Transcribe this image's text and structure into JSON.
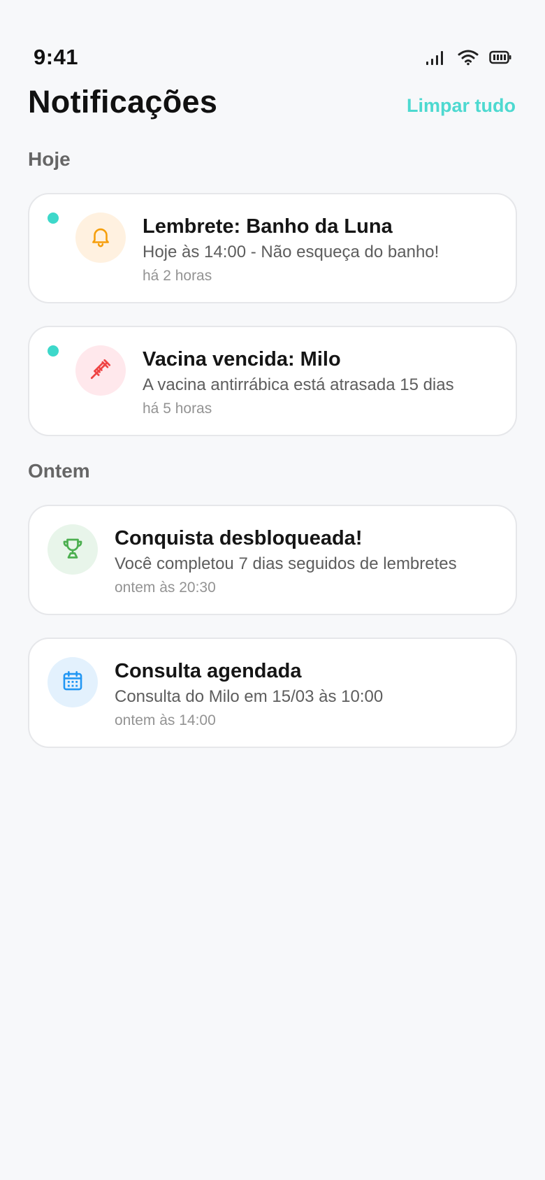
{
  "status_bar": {
    "time": "9:41"
  },
  "header": {
    "title": "Notificações",
    "clear_all_label": "Limpar tudo"
  },
  "colors": {
    "accent": "#4dd9d0",
    "unread_dot": "#3dd8ca",
    "bell_bg": "#fff1e0",
    "bell_fg": "#f59e0b",
    "syringe_bg": "#ffe8ec",
    "syringe_fg": "#ef4444",
    "trophy_bg": "#e8f5ea",
    "trophy_fg": "#4caf50",
    "calendar_bg": "#e3f1fd",
    "calendar_fg": "#2196f3"
  },
  "sections": [
    {
      "label": "Hoje",
      "items": [
        {
          "icon": "bell-icon",
          "unread": true,
          "title": "Lembrete: Banho da Luna",
          "body": "Hoje às 14:00 - Não esqueça do banho!",
          "time": "há 2 horas"
        },
        {
          "icon": "syringe-icon",
          "unread": true,
          "title": "Vacina vencida: Milo",
          "body": "A vacina antirrábica está atrasada 15 dias",
          "time": "há 5 horas"
        }
      ]
    },
    {
      "label": "Ontem",
      "items": [
        {
          "icon": "trophy-icon",
          "unread": false,
          "title": "Conquista desbloqueada!",
          "body": "Você completou 7 dias seguidos de lembretes",
          "time": "ontem às 20:30"
        },
        {
          "icon": "calendar-icon",
          "unread": false,
          "title": "Consulta agendada",
          "body": "Consulta do Milo em 15/03 às 10:00",
          "time": "ontem às 14:00"
        }
      ]
    }
  ]
}
